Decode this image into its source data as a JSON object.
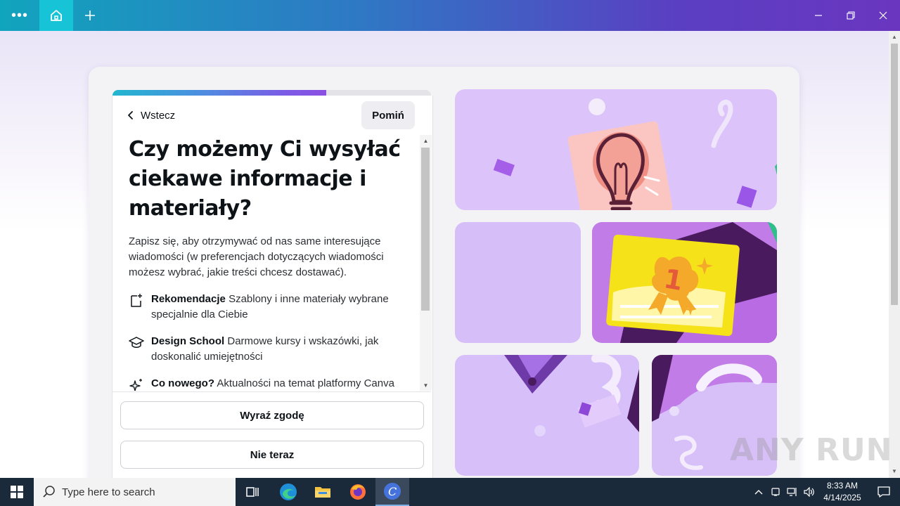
{
  "titlebar": {
    "menu_icon": "more-dots-icon",
    "home_icon": "home-icon",
    "new_tab_icon": "plus-icon",
    "controls": [
      "minimize-icon",
      "restore-icon",
      "close-icon"
    ],
    "gradient": [
      "#11a4bd",
      "#2f78c4",
      "#5a3fc2",
      "#6a36c0"
    ]
  },
  "onboarding": {
    "progress": 0.67,
    "back_label": "Wstecz",
    "skip_label": "Pomiń",
    "heading": "Czy możemy Ci wysyłać ciekawe informacje i materiały?",
    "description": "Zapisz się, aby otrzymywać od nas same interesujące wiadomości (w preferencjach dotyczących wiadomości możesz wybrać, jakie treści chcesz dostawać).",
    "benefits": [
      {
        "icon": "document-sparkle-icon",
        "title": "Rekomendacje",
        "text": "Szablony i inne materiały wybrane specjalnie dla Ciebie"
      },
      {
        "icon": "graduation-cap-icon",
        "title": "Design School",
        "text": "Darmowe kursy i wskazówki, jak doskonalić umiejętności"
      },
      {
        "icon": "sparkles-icon",
        "title": "Co nowego?",
        "text": "Aktualności na temat platformy Canva"
      }
    ],
    "agree_label": "Wyraź zgodę",
    "later_label": "Nie teraz"
  },
  "watermark": "ANY RUN",
  "taskbar": {
    "search_placeholder": "Type here to search",
    "apps": [
      "task-view-icon",
      "edge-icon",
      "file-explorer-icon",
      "firefox-icon",
      "canva-icon"
    ],
    "time": "8:33 AM",
    "date": "4/14/2025"
  },
  "colors": {
    "accent": "#8b4fe2",
    "tile_lilac": "#dcc4fb",
    "tile_purple": "#c27ce8",
    "taskbar": "#1b2a3a"
  }
}
